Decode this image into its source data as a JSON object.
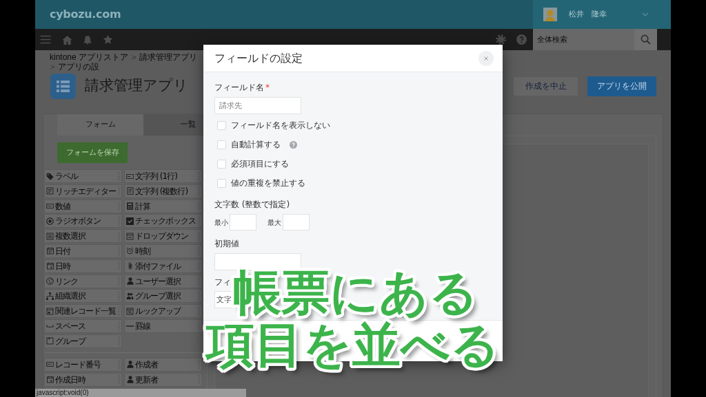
{
  "header": {
    "logo": "cybozu.com",
    "user": {
      "name": "松井　隆幸"
    }
  },
  "navbar": {
    "search": {
      "placeholder": "全体検索"
    }
  },
  "breadcrumb": [
    {
      "kind": "link",
      "text": "kintone アプリストア"
    },
    {
      "kind": "separator",
      "text": ">"
    },
    {
      "kind": "link",
      "text": "請求管理アプリ"
    },
    {
      "kind": "separator",
      "text": ">"
    },
    {
      "kind": "link",
      "text": "アプリの設"
    }
  ],
  "app": {
    "title": "請求管理アプリ"
  },
  "actions": [
    {
      "kind": "secondary",
      "label": "作成を中止"
    },
    {
      "kind": "primary",
      "label": "アプリを公開"
    }
  ],
  "tabs": [
    {
      "label": "フォーム",
      "selected": true
    },
    {
      "label": "一覧",
      "selected": false
    }
  ],
  "palette": {
    "save_button": "フォームを保存",
    "groups": [
      {
        "items": [
          {
            "kind": "label",
            "label": "ラベル"
          },
          {
            "kind": "text",
            "label": "文字列 (1行)"
          },
          {
            "kind": "richtext",
            "label": "リッチエディター"
          },
          {
            "kind": "multiline",
            "label": "文字列 (複数行)"
          },
          {
            "kind": "number",
            "label": "数値"
          },
          {
            "kind": "calc",
            "label": "計算"
          },
          {
            "kind": "radio",
            "label": "ラジオボタン"
          },
          {
            "kind": "checkbox",
            "label": "チェックボックス"
          },
          {
            "kind": "multiselect",
            "label": "複数選択"
          },
          {
            "kind": "dropdown",
            "label": "ドロップダウン"
          },
          {
            "kind": "date",
            "label": "日付"
          },
          {
            "kind": "time",
            "label": "時刻"
          },
          {
            "kind": "datetime",
            "label": "日時"
          },
          {
            "kind": "file",
            "label": "添付ファイル"
          },
          {
            "kind": "link",
            "label": "リンク"
          },
          {
            "kind": "user",
            "label": "ユーザー選択"
          },
          {
            "kind": "org",
            "label": "組織選択"
          },
          {
            "kind": "group",
            "label": "グループ選択"
          },
          {
            "kind": "related",
            "label": "関連レコード一覧"
          },
          {
            "kind": "lookup",
            "label": "ルックアップ"
          },
          {
            "kind": "space",
            "label": "スペース"
          },
          {
            "kind": "rule",
            "label": "罫線"
          },
          {
            "kind": "fieldgroup",
            "label": "グループ"
          }
        ]
      },
      {
        "items": [
          {
            "kind": "recordno",
            "label": "レコード番号"
          },
          {
            "kind": "creator",
            "label": "作成者"
          },
          {
            "kind": "created",
            "label": "作成日時"
          },
          {
            "kind": "modifier",
            "label": "更新者"
          }
        ]
      }
    ]
  },
  "dialog": {
    "title": "フィールドの設定",
    "field_name": {
      "label": "フィールド名",
      "required_mark": "*",
      "value": "請求先"
    },
    "options": [
      {
        "label": "フィールド名を表示しない",
        "checked": false,
        "help": false
      },
      {
        "label": "自動計算する",
        "checked": false,
        "help": true
      },
      {
        "label": "必須項目にする",
        "checked": false,
        "help": false
      },
      {
        "label": "値の重複を禁止する",
        "checked": false,
        "help": false
      }
    ],
    "length": {
      "label": "文字数 (整数で指定)",
      "min_label": "最小",
      "max_label": "最大"
    },
    "default_value": {
      "label": "初期値"
    },
    "field_code": {
      "label": "フィ",
      "value": "文字"
    }
  },
  "caption": {
    "lines": [
      "帳票にある",
      "項目を並べる"
    ]
  },
  "status_bar": "javascript:void(0)"
}
